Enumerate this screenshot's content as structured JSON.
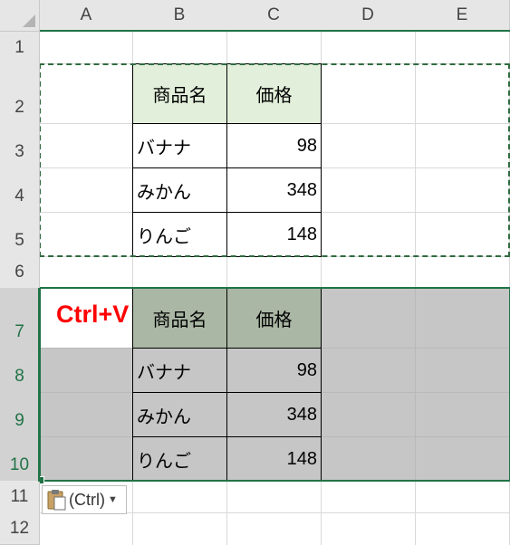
{
  "columns": [
    "A",
    "B",
    "C",
    "D",
    "E"
  ],
  "rows": [
    "1",
    "2",
    "3",
    "4",
    "5",
    "6",
    "7",
    "8",
    "9",
    "10",
    "11",
    "12"
  ],
  "source_table": {
    "headers": [
      "商品名",
      "価格"
    ],
    "rows": [
      {
        "name": "バナナ",
        "price": "98"
      },
      {
        "name": "みかん",
        "price": "348"
      },
      {
        "name": "りんご",
        "price": "148"
      }
    ]
  },
  "pasted_table": {
    "headers": [
      "商品名",
      "価格"
    ],
    "rows": [
      {
        "name": "バナナ",
        "price": "98"
      },
      {
        "name": "みかん",
        "price": "348"
      },
      {
        "name": "りんご",
        "price": "148"
      }
    ]
  },
  "annotation": "Ctrl+V",
  "paste_options": {
    "label": "(Ctrl)",
    "icon": "clipboard-paste-icon",
    "dropdown_icon": "dropdown-caret-icon"
  },
  "colors": {
    "header_fill": "#e2efda",
    "selection_gray": "#c6c6c6",
    "accent": "#217346",
    "annotation": "#ff0000"
  }
}
